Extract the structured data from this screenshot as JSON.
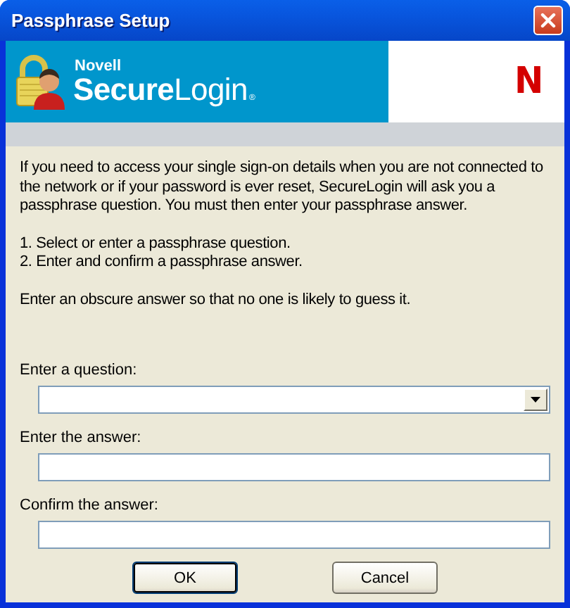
{
  "window": {
    "title": "Passphrase Setup"
  },
  "banner": {
    "vendor": "Novell",
    "product": "**Secure**Login",
    "registered": "®",
    "logo_mark": "N"
  },
  "instructions": [
    "If you need to access your single sign-on details when you are not connected to the network or if your password is ever reset, SecureLogin will ask you a passphrase question. You must then enter your passphrase answer.",
    "1. Select or enter a passphrase question.\n2. Enter and confirm a passphrase answer.",
    "Enter an obscure answer so that no one is likely to guess it."
  ],
  "fields": [
    {
      "kind": "combo",
      "label": "Enter a question:"
    },
    {
      "kind": "text",
      "label": "Enter the answer:"
    },
    {
      "kind": "text",
      "label": "Confirm the answer:"
    }
  ],
  "buttons": [
    {
      "label": "OK",
      "default": true
    },
    {
      "label": "Cancel",
      "default": false
    }
  ]
}
